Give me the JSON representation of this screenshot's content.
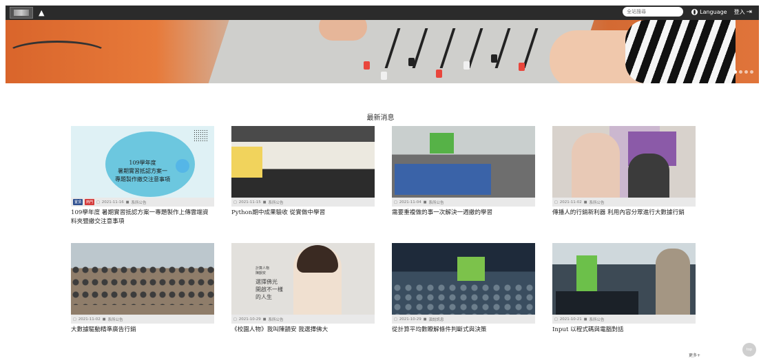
{
  "header": {
    "home_icon": "home-icon",
    "search_placeholder": "全站搜尋",
    "language_label": "Language",
    "login_label": "登入"
  },
  "banner": {
    "slide_count": 4,
    "active_slide": 0
  },
  "news": {
    "title": "最新消息",
    "items": [
      {
        "tags": [
          "置頂",
          "熱門"
        ],
        "date": "2021-11-16",
        "category": "系所公告",
        "title": "109學年度 暑期實習抵認方案一專題製作上傳雲端資料夾暨繳交注意事項",
        "thumb_text": [
          "109學年度",
          "暑期實習抵認方案一",
          "專題製作繳交注意事項"
        ]
      },
      {
        "date": "2021-11-15",
        "category": "系所公告",
        "title": "Python期中成果驗收 從實做中學習"
      },
      {
        "date": "2021-11-04",
        "category": "系所公告",
        "title": "需要重複做的事一次解決一週繳的學習"
      },
      {
        "date": "2021-11-02",
        "category": "系所公告",
        "title": "傳播人的行銷新利器 利用內容分眾進行大數據行銷"
      },
      {
        "date": "2021-11-02",
        "category": "系所公告",
        "title": "大數據驅動精準廣告行銷"
      },
      {
        "date": "2021-10-29",
        "category": "系所公告",
        "title": "《校園人物》我叫陳韻安 我選擇佛大",
        "thumb_text": [
          "計算人物",
          "陳韻安",
          "選擇佛光",
          "開啟不一樣",
          "的人生"
        ]
      },
      {
        "date": "2021-10-29",
        "category": "演說訊息",
        "title": "從計算平均數瞭解條件判斷式與決策"
      },
      {
        "date": "2021-10-21",
        "category": "系所公告",
        "title": "Input 以程式碼與電腦對話"
      }
    ],
    "more_label": "更多+"
  },
  "back_to_top": "top"
}
